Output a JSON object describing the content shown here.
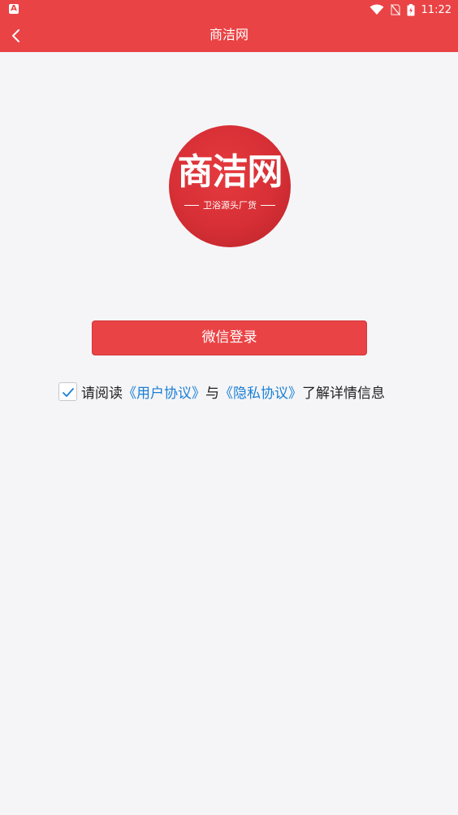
{
  "status_bar": {
    "time": "11:22"
  },
  "nav": {
    "title": "商洁网"
  },
  "logo": {
    "brand": "商洁网",
    "tagline": "卫浴源头厂货"
  },
  "login": {
    "wechat_label": "微信登录"
  },
  "agreement": {
    "checked": true,
    "prefix": "请阅读",
    "user_agreement": "《用户协议》",
    "and": "与",
    "privacy_policy": "《隐私协议》",
    "suffix": "了解详情信息"
  },
  "colors": {
    "primary": "#ea4345",
    "link": "#1a7fd4",
    "background": "#f5f5f7"
  }
}
